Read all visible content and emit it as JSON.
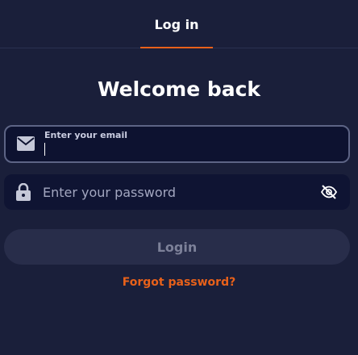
{
  "tabs": {
    "active_label": "Log in"
  },
  "heading": "Welcome back",
  "email_field": {
    "label": "Enter your email",
    "value": "",
    "icon": "envelope-icon"
  },
  "password_field": {
    "placeholder": "Enter your password",
    "value": "",
    "icon": "lock-icon",
    "toggle_icon": "eye-off-icon"
  },
  "login_button": {
    "label": "Login"
  },
  "forgot_link": {
    "label": "Forgot password?"
  },
  "colors": {
    "background": "#1a1f3a",
    "accent": "#e8611a",
    "input_bg": "#0d1230",
    "button_bg": "#282d4a"
  }
}
